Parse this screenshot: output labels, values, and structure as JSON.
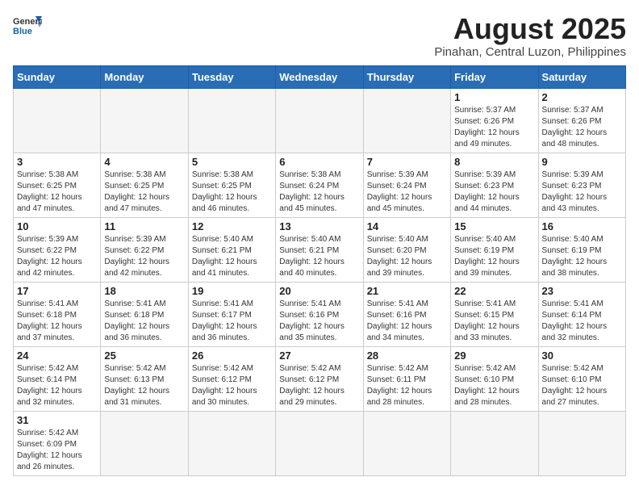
{
  "header": {
    "logo_general": "General",
    "logo_blue": "Blue",
    "month_title": "August 2025",
    "location": "Pinahan, Central Luzon, Philippines"
  },
  "days_of_week": [
    "Sunday",
    "Monday",
    "Tuesday",
    "Wednesday",
    "Thursday",
    "Friday",
    "Saturday"
  ],
  "weeks": [
    [
      {
        "day": "",
        "info": ""
      },
      {
        "day": "",
        "info": ""
      },
      {
        "day": "",
        "info": ""
      },
      {
        "day": "",
        "info": ""
      },
      {
        "day": "",
        "info": ""
      },
      {
        "day": "1",
        "info": "Sunrise: 5:37 AM\nSunset: 6:26 PM\nDaylight: 12 hours and 49 minutes."
      },
      {
        "day": "2",
        "info": "Sunrise: 5:37 AM\nSunset: 6:26 PM\nDaylight: 12 hours and 48 minutes."
      }
    ],
    [
      {
        "day": "3",
        "info": "Sunrise: 5:38 AM\nSunset: 6:25 PM\nDaylight: 12 hours and 47 minutes."
      },
      {
        "day": "4",
        "info": "Sunrise: 5:38 AM\nSunset: 6:25 PM\nDaylight: 12 hours and 47 minutes."
      },
      {
        "day": "5",
        "info": "Sunrise: 5:38 AM\nSunset: 6:25 PM\nDaylight: 12 hours and 46 minutes."
      },
      {
        "day": "6",
        "info": "Sunrise: 5:38 AM\nSunset: 6:24 PM\nDaylight: 12 hours and 45 minutes."
      },
      {
        "day": "7",
        "info": "Sunrise: 5:39 AM\nSunset: 6:24 PM\nDaylight: 12 hours and 45 minutes."
      },
      {
        "day": "8",
        "info": "Sunrise: 5:39 AM\nSunset: 6:23 PM\nDaylight: 12 hours and 44 minutes."
      },
      {
        "day": "9",
        "info": "Sunrise: 5:39 AM\nSunset: 6:23 PM\nDaylight: 12 hours and 43 minutes."
      }
    ],
    [
      {
        "day": "10",
        "info": "Sunrise: 5:39 AM\nSunset: 6:22 PM\nDaylight: 12 hours and 42 minutes."
      },
      {
        "day": "11",
        "info": "Sunrise: 5:39 AM\nSunset: 6:22 PM\nDaylight: 12 hours and 42 minutes."
      },
      {
        "day": "12",
        "info": "Sunrise: 5:40 AM\nSunset: 6:21 PM\nDaylight: 12 hours and 41 minutes."
      },
      {
        "day": "13",
        "info": "Sunrise: 5:40 AM\nSunset: 6:21 PM\nDaylight: 12 hours and 40 minutes."
      },
      {
        "day": "14",
        "info": "Sunrise: 5:40 AM\nSunset: 6:20 PM\nDaylight: 12 hours and 39 minutes."
      },
      {
        "day": "15",
        "info": "Sunrise: 5:40 AM\nSunset: 6:19 PM\nDaylight: 12 hours and 39 minutes."
      },
      {
        "day": "16",
        "info": "Sunrise: 5:40 AM\nSunset: 6:19 PM\nDaylight: 12 hours and 38 minutes."
      }
    ],
    [
      {
        "day": "17",
        "info": "Sunrise: 5:41 AM\nSunset: 6:18 PM\nDaylight: 12 hours and 37 minutes."
      },
      {
        "day": "18",
        "info": "Sunrise: 5:41 AM\nSunset: 6:18 PM\nDaylight: 12 hours and 36 minutes."
      },
      {
        "day": "19",
        "info": "Sunrise: 5:41 AM\nSunset: 6:17 PM\nDaylight: 12 hours and 36 minutes."
      },
      {
        "day": "20",
        "info": "Sunrise: 5:41 AM\nSunset: 6:16 PM\nDaylight: 12 hours and 35 minutes."
      },
      {
        "day": "21",
        "info": "Sunrise: 5:41 AM\nSunset: 6:16 PM\nDaylight: 12 hours and 34 minutes."
      },
      {
        "day": "22",
        "info": "Sunrise: 5:41 AM\nSunset: 6:15 PM\nDaylight: 12 hours and 33 minutes."
      },
      {
        "day": "23",
        "info": "Sunrise: 5:41 AM\nSunset: 6:14 PM\nDaylight: 12 hours and 32 minutes."
      }
    ],
    [
      {
        "day": "24",
        "info": "Sunrise: 5:42 AM\nSunset: 6:14 PM\nDaylight: 12 hours and 32 minutes."
      },
      {
        "day": "25",
        "info": "Sunrise: 5:42 AM\nSunset: 6:13 PM\nDaylight: 12 hours and 31 minutes."
      },
      {
        "day": "26",
        "info": "Sunrise: 5:42 AM\nSunset: 6:12 PM\nDaylight: 12 hours and 30 minutes."
      },
      {
        "day": "27",
        "info": "Sunrise: 5:42 AM\nSunset: 6:12 PM\nDaylight: 12 hours and 29 minutes."
      },
      {
        "day": "28",
        "info": "Sunrise: 5:42 AM\nSunset: 6:11 PM\nDaylight: 12 hours and 28 minutes."
      },
      {
        "day": "29",
        "info": "Sunrise: 5:42 AM\nSunset: 6:10 PM\nDaylight: 12 hours and 28 minutes."
      },
      {
        "day": "30",
        "info": "Sunrise: 5:42 AM\nSunset: 6:10 PM\nDaylight: 12 hours and 27 minutes."
      }
    ],
    [
      {
        "day": "31",
        "info": "Sunrise: 5:42 AM\nSunset: 6:09 PM\nDaylight: 12 hours and 26 minutes."
      },
      {
        "day": "",
        "info": ""
      },
      {
        "day": "",
        "info": ""
      },
      {
        "day": "",
        "info": ""
      },
      {
        "day": "",
        "info": ""
      },
      {
        "day": "",
        "info": ""
      },
      {
        "day": "",
        "info": ""
      }
    ]
  ]
}
